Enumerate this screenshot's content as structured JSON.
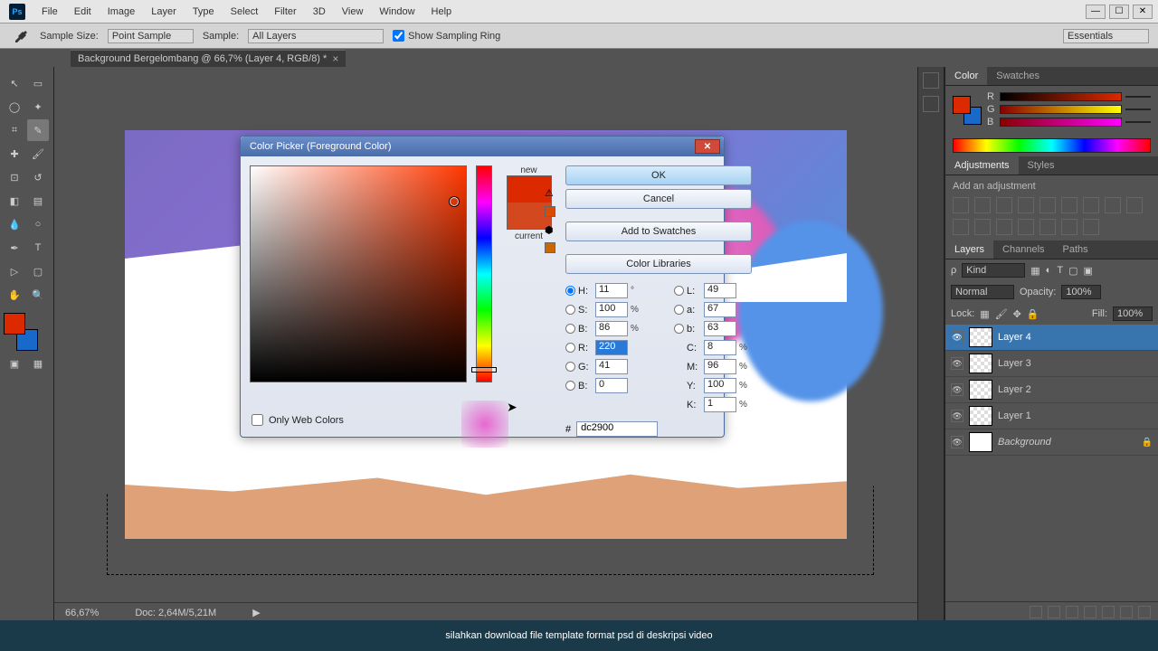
{
  "menubar": {
    "items": [
      "File",
      "Edit",
      "Image",
      "Layer",
      "Type",
      "Select",
      "Filter",
      "3D",
      "View",
      "Window",
      "Help"
    ]
  },
  "options": {
    "sample_size_label": "Sample Size:",
    "sample_size_value": "Point Sample",
    "sample_label": "Sample:",
    "sample_value": "All Layers",
    "show_sampling_ring": "Show Sampling Ring",
    "workspace": "Essentials"
  },
  "tab": {
    "title": "Background Bergelombang @ 66,7% (Layer 4, RGB/8) *"
  },
  "status": {
    "zoom": "66,67%",
    "doc": "Doc: 2,64M/5,21M"
  },
  "color_panel": {
    "tabs": [
      "Color",
      "Swatches"
    ],
    "r": "",
    "g": "",
    "b": ""
  },
  "adjustments": {
    "tabs": [
      "Adjustments",
      "Styles"
    ],
    "title": "Add an adjustment"
  },
  "layers": {
    "tabs": [
      "Layers",
      "Channels",
      "Paths"
    ],
    "kind": "Kind",
    "blend_mode": "Normal",
    "opacity_label": "Opacity:",
    "opacity_value": "100%",
    "lock_label": "Lock:",
    "fill_label": "Fill:",
    "fill_value": "100%",
    "items": [
      {
        "name": "Layer 4",
        "selected": true,
        "locked": false
      },
      {
        "name": "Layer 3",
        "selected": false,
        "locked": false
      },
      {
        "name": "Layer 2",
        "selected": false,
        "locked": false
      },
      {
        "name": "Layer 1",
        "selected": false,
        "locked": false
      },
      {
        "name": "Background",
        "selected": false,
        "locked": true
      }
    ]
  },
  "dialog": {
    "title": "Color Picker (Foreground Color)",
    "new_label": "new",
    "current_label": "current",
    "ok": "OK",
    "cancel": "Cancel",
    "add_swatches": "Add to Swatches",
    "color_libraries": "Color Libraries",
    "H": "11",
    "S": "100",
    "Bv": "86",
    "R": "220",
    "G": "41",
    "Bb": "0",
    "L": "49",
    "a": "67",
    "bl": "63",
    "C": "8",
    "M": "96",
    "Y": "100",
    "K": "1",
    "hex": "dc2900",
    "only_web": "Only Web Colors"
  },
  "subtitle": "silahkan download file template format psd di deskripsi video",
  "colors": {
    "fg": "#dc2900",
    "bg": "#1869c9"
  }
}
